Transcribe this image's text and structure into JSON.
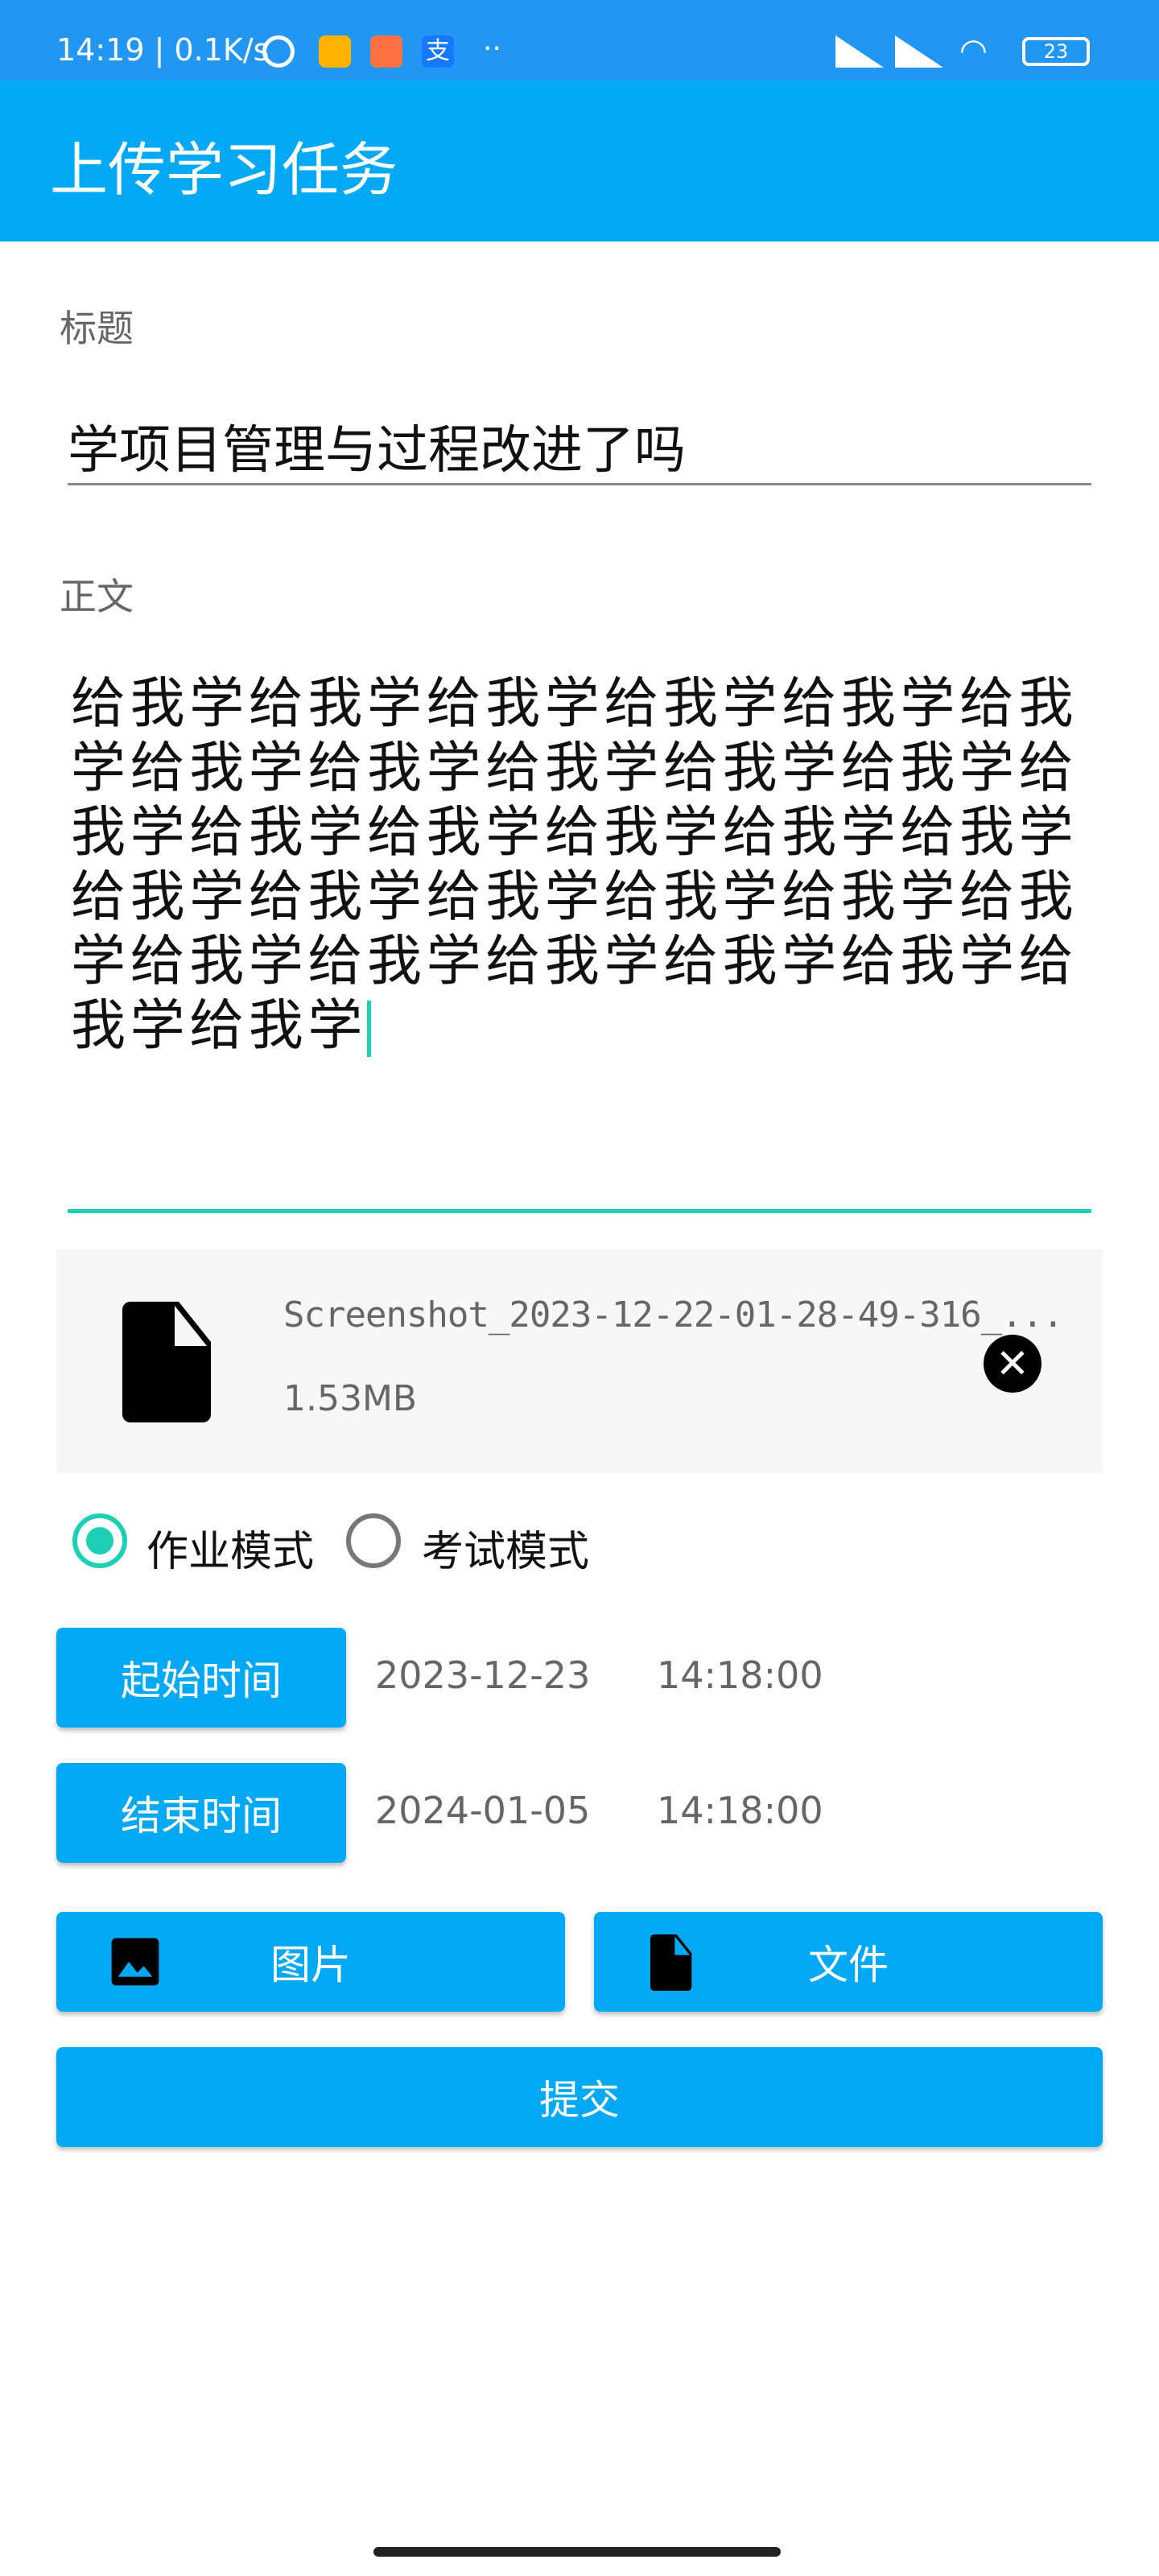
{
  "status_bar": {
    "time": "14:19",
    "net_speed": "0.1K/s",
    "battery": "23",
    "icons": [
      "alarm-icon",
      "file-manager-icon",
      "mi-store-icon",
      "alipay-icon",
      "more-dots-icon",
      "signal-hd-icon",
      "signal-hd-icon",
      "wifi-icon",
      "battery-icon"
    ]
  },
  "app_bar": {
    "title": "上传学习任务"
  },
  "form": {
    "title_label": "标题",
    "title_value": "学项目管理与过程改进了吗",
    "body_label": "正文",
    "body_value": "给我学给我学给我学给我学给我学给我学给我学给我学给我学给我学给我学给我学给我学给我学给我学给我学给我学给我学给我学给我学给我学给我学给我学给我学给我学给我学给我学给我学给我学给我学",
    "attachment": {
      "name": "Screenshot_2023-12-22-01-28-49-316_...",
      "size": "1.53MB"
    },
    "mode_options": [
      {
        "label": "作业模式",
        "selected": true
      },
      {
        "label": "考试模式",
        "selected": false
      }
    ],
    "start_button": "起始时间",
    "start_date": "2023-12-23",
    "start_time": "14:18:00",
    "end_button": "结束时间",
    "end_date": "2024-01-05",
    "end_time": "14:18:00",
    "image_button": "图片",
    "file_button": "文件",
    "submit_button": "提交"
  },
  "colors": {
    "status": "#2196f3",
    "primary": "#03a9f4",
    "accent": "#1ccfb5"
  }
}
